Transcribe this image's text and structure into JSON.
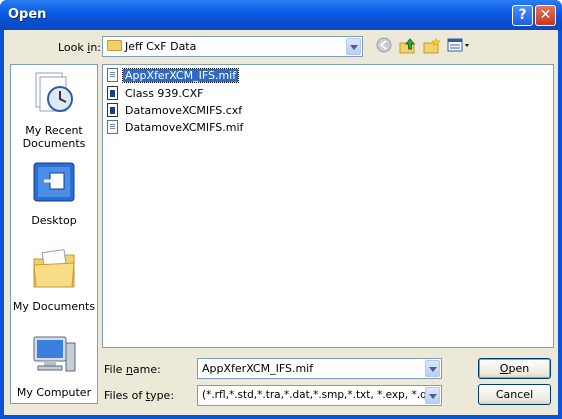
{
  "window": {
    "title": "Open",
    "help_glyph": "?",
    "close_glyph": "✕"
  },
  "lookin": {
    "label_pre": "Look ",
    "label_accel": "i",
    "label_post": "n:",
    "value": "Jeff CxF Data"
  },
  "toolbar": {
    "back_icon": "back-icon",
    "up_icon": "up-folder-icon",
    "new_folder_icon": "new-folder-icon",
    "views_icon": "views-menu-icon"
  },
  "places": [
    {
      "line1": "My Recent",
      "line2": "Documents",
      "icon": "recent-documents-icon"
    },
    {
      "line1": "Desktop",
      "line2": "",
      "icon": "desktop-icon"
    },
    {
      "line1": "My Documents",
      "line2": "",
      "icon": "my-documents-icon"
    },
    {
      "line1": "My Computer",
      "line2": "",
      "icon": "my-computer-icon"
    }
  ],
  "files": [
    {
      "name": "AppXferXCM_IFS.mif",
      "type": "mif",
      "selected": true
    },
    {
      "name": "Class 939.CXF",
      "type": "cxf",
      "selected": false
    },
    {
      "name": "DatamoveXCMIFS.cxf",
      "type": "cxf",
      "selected": false
    },
    {
      "name": "DatamoveXCMIFS.mif",
      "type": "mif",
      "selected": false
    }
  ],
  "filename": {
    "label_pre": "File ",
    "label_accel": "n",
    "label_post": "ame:",
    "value": "AppXferXCM_IFS.mif"
  },
  "filetype": {
    "label_pre": "Files of ",
    "label_accel": "t",
    "label_post": "ype:",
    "value": "(*.rfl,*.std,*.tra,*.dat,*.smp,*.txt, *.exp, *.qtx, *.pal"
  },
  "buttons": {
    "open_accel": "O",
    "open_rest": "pen",
    "cancel": "Cancel"
  }
}
